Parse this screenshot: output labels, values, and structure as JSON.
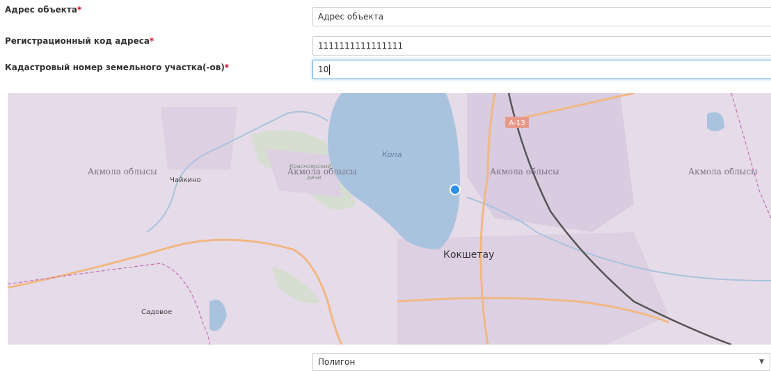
{
  "form": {
    "address_label": "Адрес объекта",
    "address_value": "Адрес объекта",
    "regcode_label": "Регистрационный код адреса",
    "regcode_value": "1111111111111111",
    "cadastral_label": "Кадастровый номер земельного участка(-ов)",
    "cadastral_value": "10",
    "required_mark": "*"
  },
  "map": {
    "region_label_1": "Акмола облысы",
    "region_label_2": "Акмола облысы",
    "region_label_3": "Акмола облысы",
    "region_label_4": "Акмола облысы",
    "village_chaikino": "Чайкино",
    "village_sadovoe": "Садовое",
    "lake_label": "Копа",
    "city_label": "Кокшетау",
    "road_label": "А-13",
    "small_label": "Красноярский",
    "small_label_2": "дачи",
    "colors": {
      "background": "#e6dbe8",
      "water": "#a9c3de",
      "road": "#f0b883",
      "railway": "#555555"
    }
  },
  "geometry_select": {
    "value": "Полигон"
  }
}
